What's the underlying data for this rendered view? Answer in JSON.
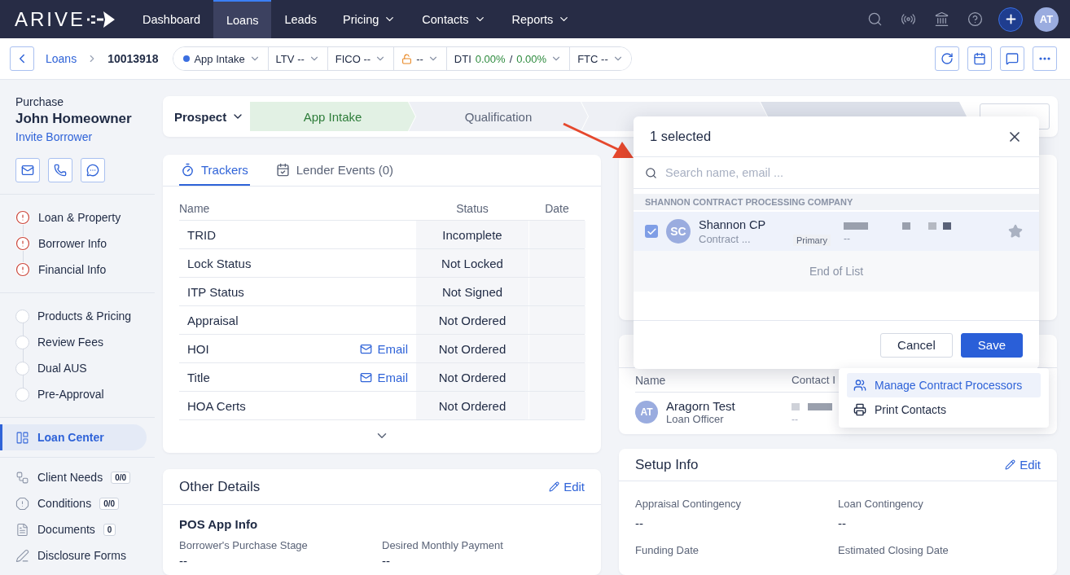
{
  "nav": {
    "logo": "ARIVE",
    "items": [
      {
        "label": "Dashboard",
        "selected": false,
        "dropdown": false
      },
      {
        "label": "Loans",
        "selected": true,
        "dropdown": false
      },
      {
        "label": "Leads",
        "selected": false,
        "dropdown": false
      },
      {
        "label": "Pricing",
        "selected": false,
        "dropdown": true
      },
      {
        "label": "Contacts",
        "selected": false,
        "dropdown": true
      },
      {
        "label": "Reports",
        "selected": false,
        "dropdown": true
      }
    ],
    "avatar": "AT"
  },
  "subbar": {
    "breadcrumb": [
      "Loans",
      "10013918"
    ],
    "pills": [
      {
        "kind": "status",
        "label": "App Intake"
      },
      {
        "kind": "metric",
        "label": "LTV",
        "value": "--"
      },
      {
        "kind": "metric",
        "label": "FICO",
        "value": "--"
      },
      {
        "kind": "lock",
        "value": "--"
      },
      {
        "kind": "ratio",
        "label": "DTI",
        "values": [
          "0.00%",
          "0.00%"
        ],
        "separator": "/"
      },
      {
        "kind": "metric",
        "label": "FTC",
        "value": "--"
      }
    ]
  },
  "borrower": {
    "loan_type": "Purchase",
    "name": "John Homeowner",
    "invite": "Invite Borrower"
  },
  "sidebar": {
    "sections": [
      {
        "kind": "stepper",
        "items": [
          {
            "label": "Loan & Property",
            "error": true
          },
          {
            "label": "Borrower Info",
            "error": true
          },
          {
            "label": "Financial Info",
            "error": true
          }
        ]
      },
      {
        "kind": "stepper",
        "items": [
          {
            "label": "Products & Pricing",
            "error": false
          },
          {
            "label": "Review Fees",
            "error": false
          },
          {
            "label": "Dual AUS",
            "error": false
          },
          {
            "label": "Pre-Approval",
            "error": false
          }
        ]
      },
      {
        "kind": "nav",
        "items": [
          {
            "label": "Loan Center",
            "selected": true
          }
        ]
      },
      {
        "kind": "nav",
        "items": [
          {
            "label": "Client Needs",
            "badge": "0/0",
            "selected": false
          },
          {
            "label": "Conditions",
            "badge": "0/0",
            "selected": false
          },
          {
            "label": "Documents",
            "badge": "0",
            "selected": false
          },
          {
            "label": "Disclosure Forms",
            "selected": false
          }
        ]
      }
    ]
  },
  "stage_bar": {
    "dropdown": "Prospect",
    "steps": [
      {
        "kind": "stage",
        "label": "App Intake",
        "current": true
      },
      {
        "kind": "stage",
        "label": "Qualification",
        "current": false
      },
      {
        "kind": "stage",
        "current": false
      },
      {
        "kind": "action",
        "current": false
      }
    ]
  },
  "trackers": {
    "tabs": [
      {
        "label": "Trackers",
        "selected": true
      },
      {
        "label": "Lender Events (0)",
        "selected": false
      }
    ],
    "columns": [
      "Name",
      "Status",
      "Date"
    ],
    "rows": [
      {
        "name": "TRID",
        "status": "Incomplete"
      },
      {
        "name": "Lock Status",
        "status": "Not Locked"
      },
      {
        "name": "ITP Status",
        "status": "Not Signed"
      },
      {
        "name": "Appraisal",
        "status": "Not Ordered"
      },
      {
        "name": "HOI",
        "link": "Email",
        "status": "Not Ordered"
      },
      {
        "name": "Title",
        "link": "Email",
        "status": "Not Ordered"
      },
      {
        "name": "HOA Certs",
        "status": "Not Ordered"
      }
    ]
  },
  "other_details": {
    "title": "Other Details",
    "edit": "Edit",
    "section": "POS App Info",
    "fields": [
      {
        "label": "Borrower's Purchase Stage",
        "value": "--"
      },
      {
        "label": "Desired Monthly Payment",
        "value": "--"
      }
    ]
  },
  "contacts": {
    "columns": [
      "Name",
      "Contact I"
    ],
    "rows": [
      {
        "initials": "AT",
        "name": "Aragorn Test",
        "role": "Loan Officer",
        "contact_2": "--"
      }
    ]
  },
  "setup_info": {
    "title": "Setup Info",
    "edit": "Edit",
    "fields": [
      {
        "label": "Appraisal Contingency",
        "value": "--"
      },
      {
        "label": "Loan Contingency",
        "value": "--"
      },
      {
        "label": "Funding Date"
      },
      {
        "label": "Estimated Closing Date"
      }
    ]
  },
  "modal": {
    "title": "1 selected",
    "search_placeholder": "Search name, email ...",
    "group": "SHANNON CONTRACT PROCESSING COMPANY",
    "rows": [
      {
        "checked": true,
        "initials": "SC",
        "name": "Shannon CP",
        "role": "Contract ...",
        "tag": "Primary",
        "contact_2": "--",
        "starred": false
      }
    ],
    "end": "End of List",
    "buttons": [
      {
        "label": "Cancel",
        "kind": "secondary"
      },
      {
        "label": "Save",
        "kind": "primary"
      }
    ]
  },
  "menu": {
    "items": [
      {
        "label": "Manage Contract Processors",
        "selected": true
      },
      {
        "label": "Print Contacts",
        "selected": false
      }
    ]
  }
}
